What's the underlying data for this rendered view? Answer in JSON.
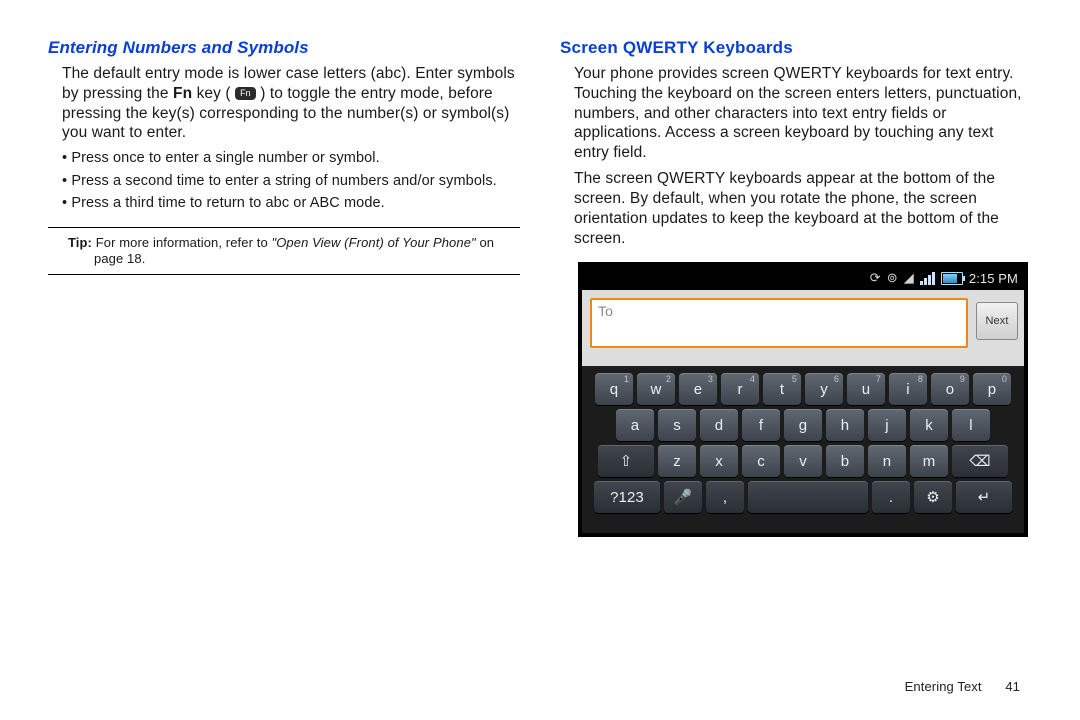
{
  "left": {
    "heading": "Entering Numbers and Symbols",
    "para_a": "The default entry mode is lower case letters (abc). Enter symbols by pressing the ",
    "fn_word": "Fn",
    "para_b": " key ( ",
    "fn_icon_label": "Fn",
    "para_c": " ) to toggle the entry mode, before pressing the key(s) corresponding to the number(s) or symbol(s) you want to enter.",
    "b1": "Press once to enter a single number or symbol.",
    "b2": "Press a second time to enter a string of numbers and/or symbols.",
    "b3": "Press a third time to return to abc or ABC mode.",
    "tip_label": "Tip:",
    "tip_a": " For more information, refer to ",
    "tip_em": "\"Open View (Front) of Your Phone\"",
    "tip_b": " on page 18."
  },
  "right": {
    "heading": "Screen QWERTY Keyboards",
    "p1": "Your phone provides screen QWERTY keyboards for text entry. Touching the keyboard on the screen enters letters, punctuation, numbers, and other characters into text entry fields or applications. Access a screen keyboard by touching any text entry field.",
    "p2": "The screen QWERTY keyboards appear at the bottom of the screen. By default, when you rotate the phone, the screen orientation updates to keep the keyboard at the bottom of the screen."
  },
  "phone": {
    "time": "2:15 PM",
    "to_placeholder": "To",
    "next_label": "Next",
    "row1": [
      "q",
      "w",
      "e",
      "r",
      "t",
      "y",
      "u",
      "i",
      "o",
      "p"
    ],
    "row1_sup": [
      "1",
      "2",
      "3",
      "4",
      "5",
      "6",
      "7",
      "8",
      "9",
      "0"
    ],
    "row2": [
      "a",
      "s",
      "d",
      "f",
      "g",
      "h",
      "j",
      "k",
      "l"
    ],
    "row3_shift": "⇧",
    "row3": [
      "z",
      "x",
      "c",
      "v",
      "b",
      "n",
      "m"
    ],
    "row3_back": "⌫",
    "row4_sym": "?123",
    "row4_mic": "🎤",
    "row4_comma": ",",
    "row4_space": "␣",
    "row4_period": ".",
    "row4_gear": "⚙",
    "row4_enter": "↵"
  },
  "footer": {
    "section": "Entering Text",
    "page": "41"
  }
}
